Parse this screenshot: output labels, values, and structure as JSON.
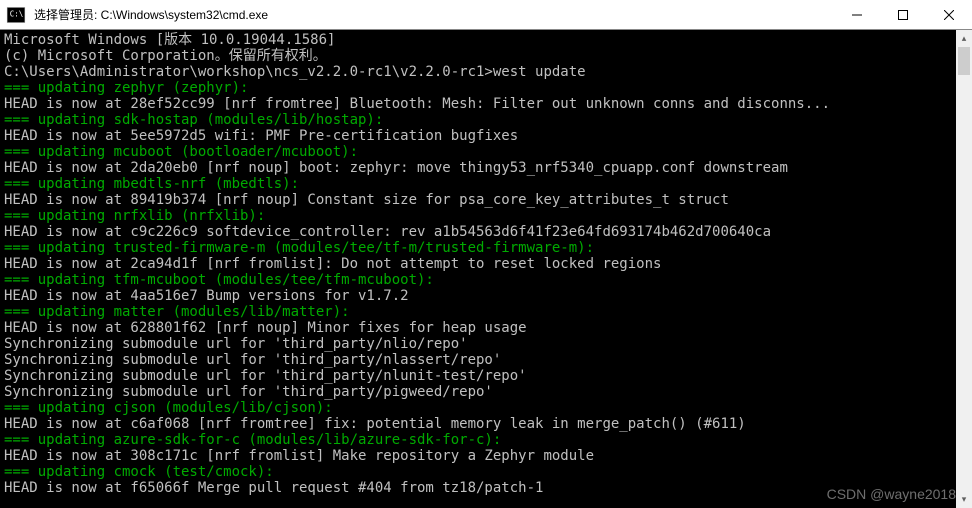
{
  "titlebar": {
    "title": "选择管理员: C:\\Windows\\system32\\cmd.exe"
  },
  "terminal": {
    "lines": [
      {
        "text": "Microsoft Windows [版本 10.0.19044.1586]",
        "class": "white"
      },
      {
        "text": "(c) Microsoft Corporation。保留所有权利。",
        "class": "white"
      },
      {
        "text": "",
        "class": "white"
      },
      {
        "text": "C:\\Users\\Administrator\\workshop\\ncs_v2.2.0-rc1\\v2.2.0-rc1>west update",
        "class": "white"
      },
      {
        "text": "=== updating zephyr (zephyr):",
        "class": "green"
      },
      {
        "text": "HEAD is now at 28ef52cc99 [nrf fromtree] Bluetooth: Mesh: Filter out unknown conns and disconns...",
        "class": "white"
      },
      {
        "text": "=== updating sdk-hostap (modules/lib/hostap):",
        "class": "green"
      },
      {
        "text": "HEAD is now at 5ee5972d5 wifi: PMF Pre-certification bugfixes",
        "class": "white"
      },
      {
        "text": "=== updating mcuboot (bootloader/mcuboot):",
        "class": "green"
      },
      {
        "text": "HEAD is now at 2da20eb0 [nrf noup] boot: zephyr: move thingy53_nrf5340_cpuapp.conf downstream",
        "class": "white"
      },
      {
        "text": "=== updating mbedtls-nrf (mbedtls):",
        "class": "green"
      },
      {
        "text": "HEAD is now at 89419b374 [nrf noup] Constant size for psa_core_key_attributes_t struct",
        "class": "white"
      },
      {
        "text": "=== updating nrfxlib (nrfxlib):",
        "class": "green"
      },
      {
        "text": "HEAD is now at c9c226c9 softdevice_controller: rev a1b54563d6f41f23e64fd693174b462d700640ca",
        "class": "white"
      },
      {
        "text": "=== updating trusted-firmware-m (modules/tee/tf-m/trusted-firmware-m):",
        "class": "green"
      },
      {
        "text": "HEAD is now at 2ca94d1f [nrf fromlist]: Do not attempt to reset locked regions",
        "class": "white"
      },
      {
        "text": "=== updating tfm-mcuboot (modules/tee/tfm-mcuboot):",
        "class": "green"
      },
      {
        "text": "HEAD is now at 4aa516e7 Bump versions for v1.7.2",
        "class": "white"
      },
      {
        "text": "=== updating matter (modules/lib/matter):",
        "class": "green"
      },
      {
        "text": "HEAD is now at 628801f62 [nrf noup] Minor fixes for heap usage",
        "class": "white"
      },
      {
        "text": "Synchronizing submodule url for 'third_party/nlio/repo'",
        "class": "white"
      },
      {
        "text": "Synchronizing submodule url for 'third_party/nlassert/repo'",
        "class": "white"
      },
      {
        "text": "Synchronizing submodule url for 'third_party/nlunit-test/repo'",
        "class": "white"
      },
      {
        "text": "Synchronizing submodule url for 'third_party/pigweed/repo'",
        "class": "white"
      },
      {
        "text": "=== updating cjson (modules/lib/cjson):",
        "class": "green"
      },
      {
        "text": "HEAD is now at c6af068 [nrf fromtree] fix: potential memory leak in merge_patch() (#611)",
        "class": "white"
      },
      {
        "text": "=== updating azure-sdk-for-c (modules/lib/azure-sdk-for-c):",
        "class": "green"
      },
      {
        "text": "HEAD is now at 308c171c [nrf fromlist] Make repository a Zephyr module",
        "class": "white"
      },
      {
        "text": "=== updating cmock (test/cmock):",
        "class": "green"
      },
      {
        "text": "HEAD is now at f65066f Merge pull request #404 from tz18/patch-1",
        "class": "white"
      }
    ]
  },
  "watermark": "CSDN @wayne2018"
}
